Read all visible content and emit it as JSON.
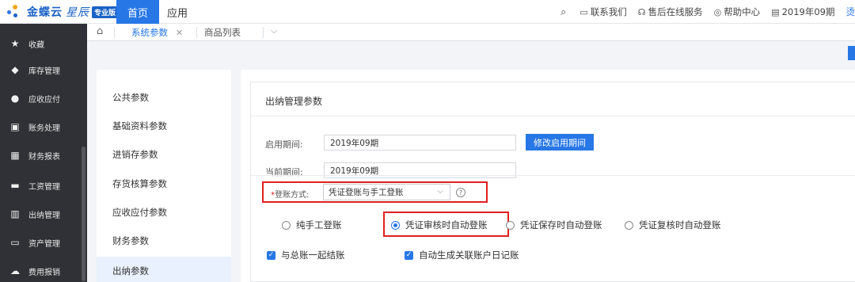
{
  "brand": {
    "name": "金蝶云",
    "edition_script": "星辰",
    "badge": "专业版"
  },
  "top_nav": {
    "home": "首页",
    "app": "应用"
  },
  "top_right": {
    "search_icon": "search-icon",
    "contact": "联系我们",
    "support": "售后在线服务",
    "help": "帮助中心",
    "period": "2019年09期",
    "user": "烫"
  },
  "sidebar": {
    "items": [
      {
        "label": "收藏",
        "icon": "star-icon"
      },
      {
        "label": "库存管理",
        "icon": "cube-icon"
      },
      {
        "label": "应收应付",
        "icon": "yen-circle-icon"
      },
      {
        "label": "账务处理",
        "icon": "ledger-icon"
      },
      {
        "label": "财务报表",
        "icon": "report-icon"
      },
      {
        "label": "工资管理",
        "icon": "salary-icon"
      },
      {
        "label": "出纳管理",
        "icon": "cashier-icon"
      },
      {
        "label": "资产管理",
        "icon": "asset-icon"
      },
      {
        "label": "费用报销",
        "icon": "expense-icon"
      }
    ]
  },
  "tabs": [
    {
      "label": "系统参数",
      "active": true,
      "closable": true
    },
    {
      "label": "商品列表",
      "active": false,
      "closable": false
    }
  ],
  "menu": {
    "items": [
      {
        "label": "公共参数"
      },
      {
        "label": "基础资料参数"
      },
      {
        "label": "进销存参数"
      },
      {
        "label": "存货核算参数"
      },
      {
        "label": "应收应付参数"
      },
      {
        "label": "财务参数"
      },
      {
        "label": "出纳参数",
        "active": true
      }
    ]
  },
  "section": {
    "title": "出纳管理参数",
    "start_period_label": "启用期间:",
    "start_period_value": "2019年09期",
    "modify_button": "修改启用期间",
    "current_period_label": "当前期间:",
    "current_period_value": "2019年09期",
    "posting_required": "*",
    "posting_label": "登账方式:",
    "posting_value": "凭证登账与手工登账",
    "help_icon": "question-circle-icon",
    "radio_options": [
      {
        "label": "纯手工登账",
        "selected": false
      },
      {
        "label": "凭证审核时自动登账",
        "selected": true
      },
      {
        "label": "凭证保存时自动登账",
        "selected": false
      },
      {
        "label": "凭证复核时自动登账",
        "selected": false
      }
    ],
    "checkboxes": [
      {
        "label": "与总账一起结账",
        "checked": true
      },
      {
        "label": "自动生成关联账户日记账",
        "checked": true
      }
    ]
  },
  "colors": {
    "accent": "#2777e6",
    "sidebar_bg": "#2f3136",
    "highlight_red": "#e02020"
  }
}
